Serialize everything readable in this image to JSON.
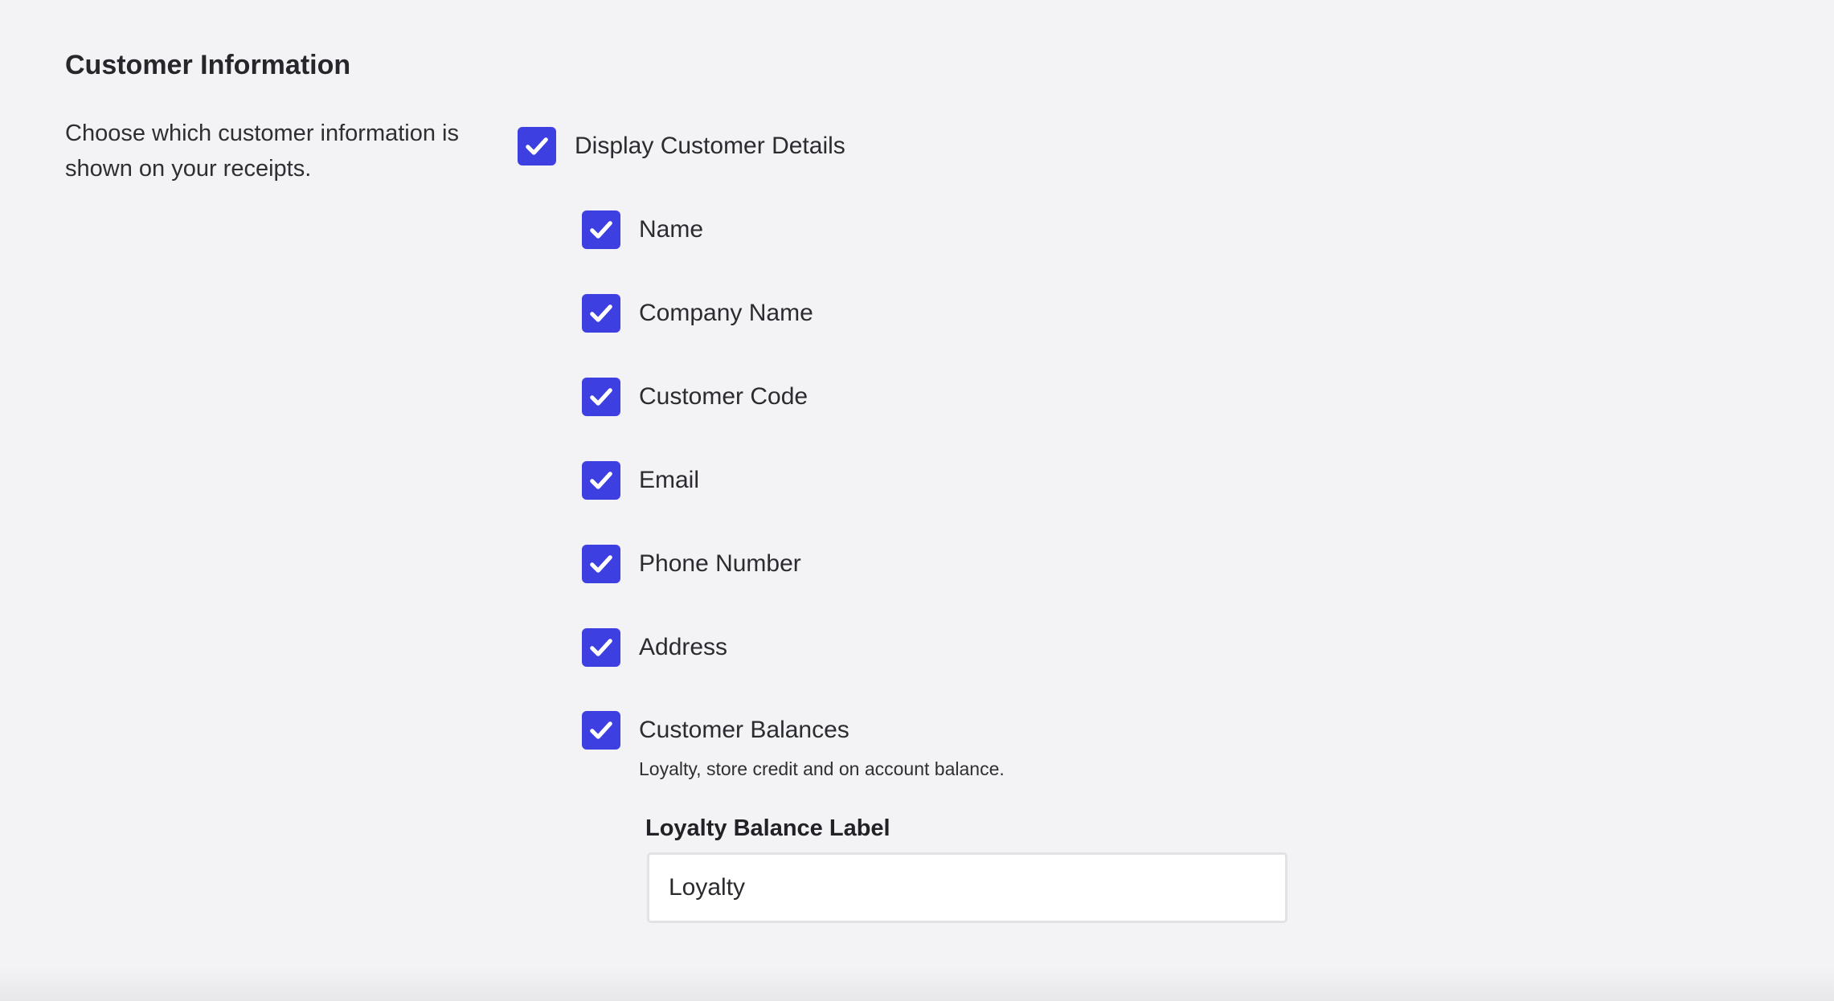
{
  "section": {
    "title": "Customer Information",
    "description": "Choose which customer information is shown on your receipts."
  },
  "master_option": {
    "label": "Display Customer Details",
    "checked": true
  },
  "options": [
    {
      "label": "Name",
      "checked": true
    },
    {
      "label": "Company Name",
      "checked": true
    },
    {
      "label": "Customer Code",
      "checked": true
    },
    {
      "label": "Email",
      "checked": true
    },
    {
      "label": "Phone Number",
      "checked": true
    },
    {
      "label": "Address",
      "checked": true
    },
    {
      "label": "Customer Balances",
      "checked": true
    }
  ],
  "balances_help": "Loyalty, store credit and on account balance.",
  "loyalty_field": {
    "label": "Loyalty Balance Label",
    "value": "Loyalty"
  },
  "colors": {
    "checkbox_accent": "#3d3fe0",
    "background": "#f3f2f5"
  },
  "icons": {
    "checkbox": "checkmark-icon"
  }
}
